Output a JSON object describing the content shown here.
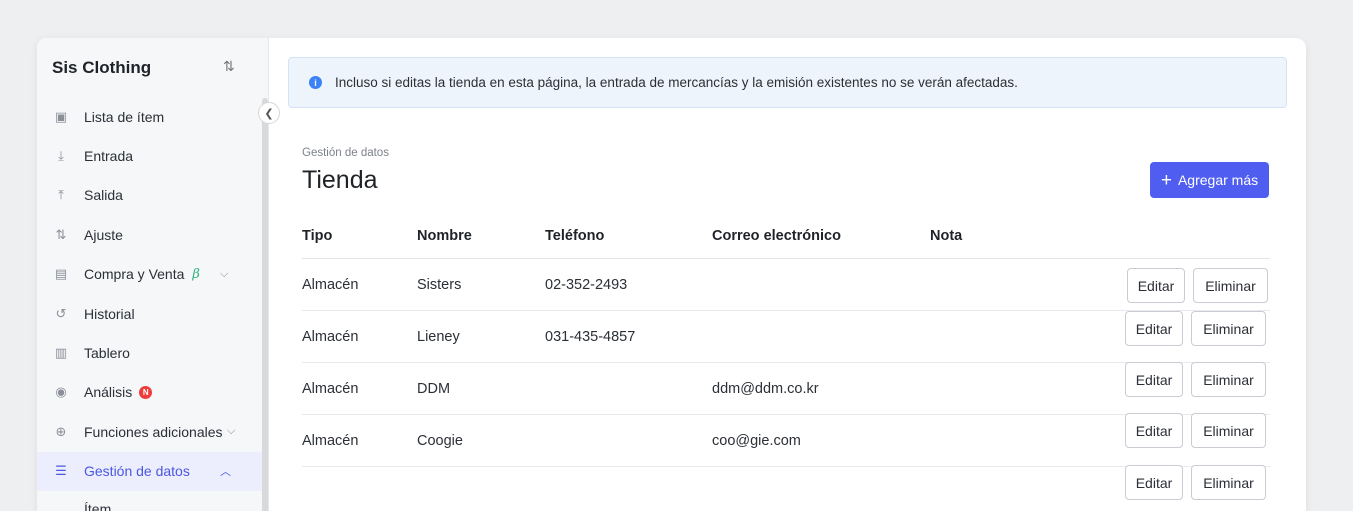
{
  "sidebar": {
    "brand": "Sis Clothing",
    "sort_icon": "sort-arrows-icon",
    "items": [
      {
        "label": "Lista de ítem",
        "icon": "box-icon"
      },
      {
        "label": "Entrada",
        "icon": "arrow-down-icon"
      },
      {
        "label": "Salida",
        "icon": "arrow-up-icon"
      },
      {
        "label": "Ajuste",
        "icon": "swap-icon"
      },
      {
        "label": "Compra y Venta",
        "icon": "document-icon",
        "tag": "β"
      },
      {
        "label": "Historial",
        "icon": "history-icon"
      },
      {
        "label": "Tablero",
        "icon": "bar-chart-icon"
      },
      {
        "label": "Análisis",
        "icon": "eye-icon",
        "badge": "N"
      },
      {
        "label": "Funciones adicionales",
        "icon": "plus-circle-icon"
      },
      {
        "label": "Gestión de datos",
        "icon": "database-icon"
      }
    ],
    "sub_items": [
      "Ítem"
    ]
  },
  "alert": {
    "text": "Incluso si editas la tienda en esta página, la entrada de mercancías y la emisión existentes no se verán afectadas."
  },
  "page": {
    "breadcrumb": "Gestión de datos",
    "title": "Tienda",
    "add_button": "Agregar más"
  },
  "table": {
    "headers": {
      "tipo": "Tipo",
      "nombre": "Nombre",
      "telefono": "Teléfono",
      "correo": "Correo electrónico",
      "nota": "Nota"
    },
    "rows": [
      {
        "tipo": "Almacén",
        "nombre": "Sisters",
        "telefono": "02-352-2493",
        "correo": "",
        "nota": ""
      },
      {
        "tipo": "Almacén",
        "nombre": "Lieney",
        "telefono": "031-435-4857",
        "correo": "",
        "nota": ""
      },
      {
        "tipo": "Almacén",
        "nombre": "DDM",
        "telefono": "",
        "correo": "ddm@ddm.co.kr",
        "nota": ""
      },
      {
        "tipo": "Almacén",
        "nombre": "Coogie",
        "telefono": "",
        "correo": "coo@gie.com",
        "nota": ""
      }
    ]
  },
  "actions": {
    "edit": "Editar",
    "delete": "Eliminar"
  },
  "colors": {
    "accent": "#4f5ef0",
    "active_bg": "#eceefd",
    "alert_bg": "#eef4fc",
    "beta": "#2eb27a",
    "badge": "#ee3b3b"
  }
}
